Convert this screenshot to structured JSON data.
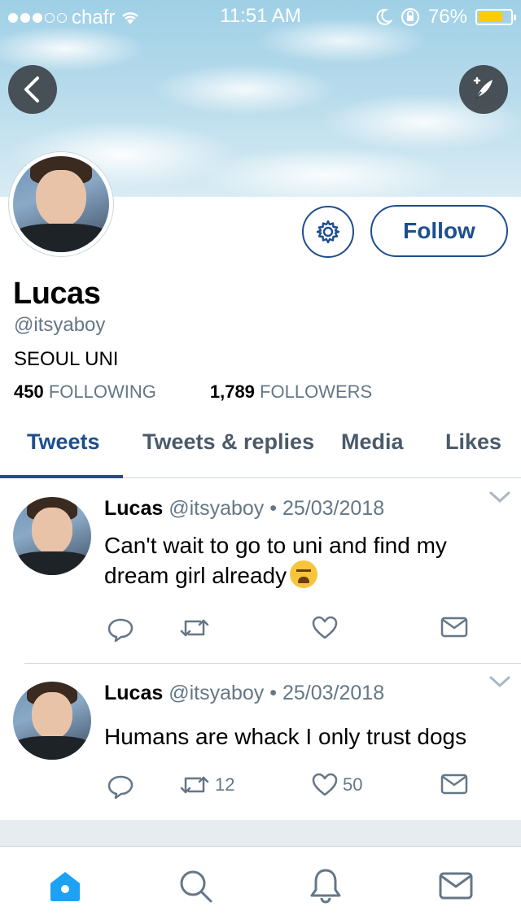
{
  "status_bar": {
    "carrier": "chafr",
    "time": "11:51 AM",
    "battery": "76%",
    "battery_level": 0.76
  },
  "profile": {
    "name": "Lucas",
    "handle": "@itsyaboy",
    "bio": "SEOUL UNI",
    "following_count": "450",
    "following_label": "FOLLOWING",
    "followers_count": "1,789",
    "followers_label": "FOLLOWERS",
    "follow_label": "Follow"
  },
  "tabs": [
    {
      "label": "Tweets",
      "active": true
    },
    {
      "label": "Tweets & replies",
      "active": false
    },
    {
      "label": "Media",
      "active": false
    },
    {
      "label": "Likes",
      "active": false
    }
  ],
  "tweets": [
    {
      "name": "Lucas",
      "handle": "@itsyaboy",
      "separator": "•",
      "date": "25/03/2018",
      "text": "Can't wait to go to uni and find my dream girl already",
      "emoji": "tired-face-emoji",
      "retweets": "",
      "likes": ""
    },
    {
      "name": "Lucas",
      "handle": "@itsyaboy",
      "separator": "•",
      "date": "25/03/2018",
      "text": "Humans are whack I only trust dogs",
      "retweets": "12",
      "likes": "50"
    }
  ],
  "colors": {
    "accent": "#1d4e8f",
    "home_icon": "#1da1f2",
    "muted": "#657786",
    "battery": "#ffcc00"
  },
  "icons": {
    "back": "back-arrow-icon",
    "compose": "compose-feather-icon",
    "settings": "gear-icon",
    "reply": "reply-icon",
    "retweet": "retweet-icon",
    "like": "heart-icon",
    "dm": "envelope-icon",
    "home": "home-icon",
    "search": "search-icon",
    "notifications": "bell-icon",
    "messages": "mail-icon"
  }
}
